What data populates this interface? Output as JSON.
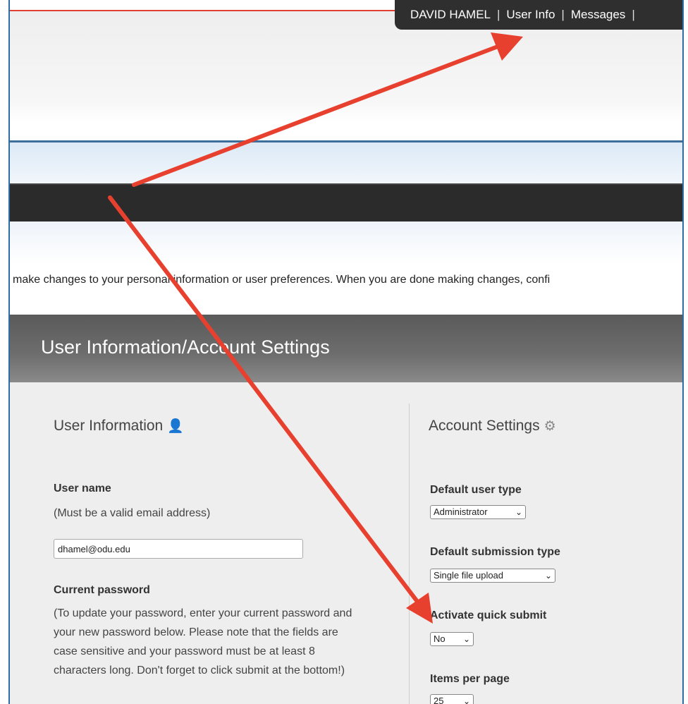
{
  "topbar": {
    "user": "DAVID HAMEL",
    "separator": "|",
    "user_info": "User Info",
    "messages": "Messages"
  },
  "intro_text": "make changes to your personal information or user preferences. When you are done making changes, confi",
  "section_title": "User Information/Account Settings",
  "user_info": {
    "heading": "User Information",
    "username_label": "User name",
    "username_note": "(Must be a valid email address)",
    "username_value": "dhamel@odu.edu",
    "password_label": "Current password",
    "password_note": "(To update your password, enter your current password and your new password below. Please note that the fields are case sensitive and your password must be at least 8 characters long. Don't forget to click submit at the bottom!)"
  },
  "account_settings": {
    "heading": "Account Settings",
    "user_type_label": "Default user type",
    "user_type_value": "Administrator",
    "submission_type_label": "Default submission type",
    "submission_type_value": "Single file upload",
    "quick_submit_label": "Activate quick submit",
    "quick_submit_value": "No",
    "items_per_page_label": "Items per page",
    "items_per_page_value": "25"
  },
  "colors": {
    "annotation_arrow": "#e8402f",
    "topbar_bg": "#2f2f2f",
    "navbar_bg": "#2b2b2b",
    "accent_blue": "#3c6f9c"
  }
}
